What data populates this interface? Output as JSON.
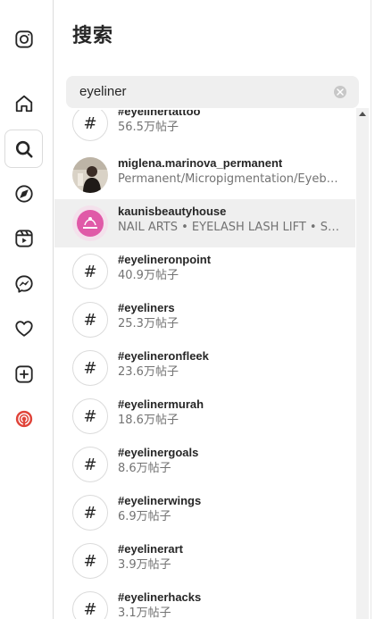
{
  "panel": {
    "title": "搜索"
  },
  "search": {
    "value": "eyeliner"
  },
  "sidebar": {
    "items": [
      {
        "name": "instagram-logo-icon"
      },
      {
        "name": "home-icon"
      },
      {
        "name": "search-icon"
      },
      {
        "name": "explore-compass-icon"
      },
      {
        "name": "reels-icon"
      },
      {
        "name": "messenger-icon"
      },
      {
        "name": "heart-icon"
      },
      {
        "name": "create-plus-icon"
      },
      {
        "name": "threads-icon"
      }
    ]
  },
  "results": [
    {
      "type": "hashtag",
      "primary": "#eyelinertattoo",
      "secondary": "56.5万帖子"
    },
    {
      "type": "account",
      "primary": "miglena.marinova_permanent",
      "secondary": "Permanent/Micropigmentation/Eyebro..."
    },
    {
      "type": "account",
      "primary": "kaunisbeautyhouse",
      "secondary": "NAIL ARTS • EYELASH LASH LIFT • SUL...",
      "selected": true
    },
    {
      "type": "hashtag",
      "primary": "#eyelineronpoint",
      "secondary": "40.9万帖子"
    },
    {
      "type": "hashtag",
      "primary": "#eyeliners",
      "secondary": "25.3万帖子"
    },
    {
      "type": "hashtag",
      "primary": "#eyelineronfleek",
      "secondary": "23.6万帖子"
    },
    {
      "type": "hashtag",
      "primary": "#eyelinermurah",
      "secondary": "18.6万帖子"
    },
    {
      "type": "hashtag",
      "primary": "#eyelinergoals",
      "secondary": "8.6万帖子"
    },
    {
      "type": "hashtag",
      "primary": "#eyelinerwings",
      "secondary": "6.9万帖子"
    },
    {
      "type": "hashtag",
      "primary": "#eyelinerart",
      "secondary": "3.9万帖子"
    },
    {
      "type": "hashtag",
      "primary": "#eyelinerhacks",
      "secondary": "3.1万帖子"
    }
  ],
  "colors": {
    "selected_bg": "#efefef",
    "secondary_text": "#737373",
    "threads_icon": "#e0443a"
  }
}
